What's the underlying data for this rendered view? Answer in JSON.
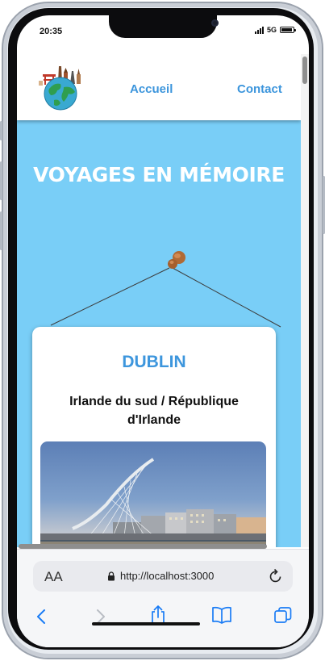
{
  "status_bar": {
    "time": "20:35",
    "network": "5G"
  },
  "nav": {
    "links": [
      "Accueil",
      "Contact"
    ]
  },
  "hero": {
    "title": "VOYAGES EN MÉMOIRE"
  },
  "card": {
    "city": "DUBLIN",
    "country": "Irlande du sud / République d'Irlande"
  },
  "browser": {
    "text_size_label": "AA",
    "url": "http://localhost:3000"
  },
  "icons": {
    "text_size": "text-size-icon",
    "lock": "lock-icon",
    "reload": "reload-icon",
    "back": "back-arrow-icon",
    "forward": "forward-arrow-icon",
    "share": "share-icon",
    "bookmarks": "bookmarks-icon",
    "tabs": "tabs-icon"
  },
  "colors": {
    "page_background": "#79cef7",
    "accent": "#3c95dc",
    "card_background": "#ffffff",
    "ios_blue": "#1a7cf5"
  }
}
